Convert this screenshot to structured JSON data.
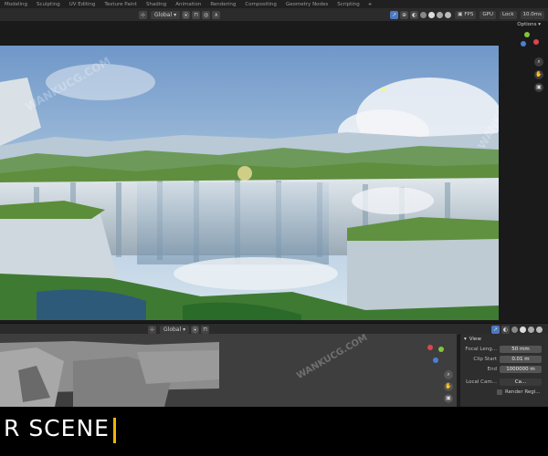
{
  "workspace_tabs": [
    "Modeling",
    "Sculpting",
    "UV Editing",
    "Texture Paint",
    "Shading",
    "Animation",
    "Rendering",
    "Compositing",
    "Geometry Nodes",
    "Scripting"
  ],
  "workspace_add": "+",
  "header": {
    "orientation": "Global",
    "fps": "FPS",
    "mode_label": "GPU",
    "frame_time": "10.0ms",
    "options": "Options",
    "lock_label": "Lock"
  },
  "lower_header": {
    "orientation": "Global"
  },
  "view_panel": {
    "title": "View",
    "focal_length_label": "Focal Leng...",
    "focal_length_value": "50 mm",
    "clip_start_label": "Clip Start",
    "clip_start_value": "0.01 m",
    "clip_end_label": "End",
    "clip_end_value": "1000000 m",
    "local_camera_label": "Local Cam...",
    "local_camera_value": "Ca...",
    "render_region_label": "Render Regi..."
  },
  "caption": {
    "text": "R SCENE"
  },
  "watermark": {
    "text": "WANKUCG.COM"
  },
  "colors": {
    "accent_blue": "#4c78c0",
    "caption_bar": "#f2b400",
    "axis_x": "#e0444e",
    "axis_y": "#86c23a",
    "axis_z": "#4a7fd9"
  },
  "icons": {
    "fullscreen": "camera-icon",
    "hand": "hand-icon",
    "zoom": "zoom-icon"
  }
}
